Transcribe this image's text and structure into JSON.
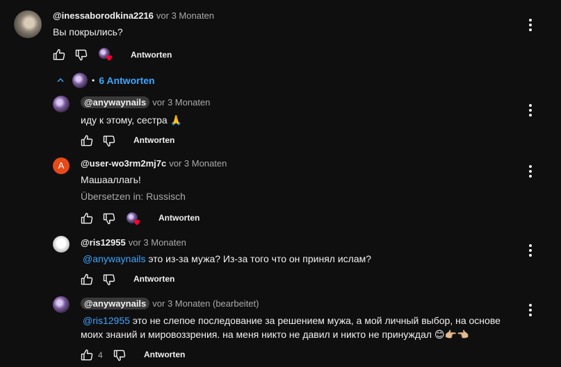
{
  "top_comment": {
    "author": "@inessaborodkina2216",
    "time": "vor 3 Monaten",
    "text": "Вы покрылись?",
    "reply_label": "Antworten"
  },
  "replies_toggle": {
    "dot": "•",
    "label": "6 Antworten"
  },
  "replies": [
    {
      "author": "@anywaynails",
      "time": "vor 3 Monaten",
      "text": "иду к этому, сестра 🙏",
      "reply_label": "Antworten"
    },
    {
      "avatar_letter": "A",
      "author": "@user-wo3rm2mj7c",
      "time": "vor 3 Monaten",
      "text": "Машааллагь!",
      "translate": "Übersetzen in: Russisch",
      "reply_label": "Antworten"
    },
    {
      "author": "@ris12955",
      "time": "vor 3 Monaten",
      "mention": "@anywaynails",
      "text": " это из-за мужа? Из-за того что он принял ислам?",
      "reply_label": "Antworten"
    },
    {
      "author": "@anywaynails",
      "time": "vor 3 Monaten (bearbeitet)",
      "mention": "@ris12955",
      "text_line1": " это не слепое последование за решением мужа, а мой личный выбор, на основе",
      "text_line2": "моих знаний и мировоззрения. на меня никто не давил и никто не принуждал 😊👉🏼👈🏼",
      "like_count": "4",
      "reply_label": "Antworten"
    }
  ],
  "colors": {
    "background": "#0f0f0f",
    "link": "#3ea6ff",
    "secondary_text": "#aaaaaa",
    "heart": "#ff0033"
  }
}
